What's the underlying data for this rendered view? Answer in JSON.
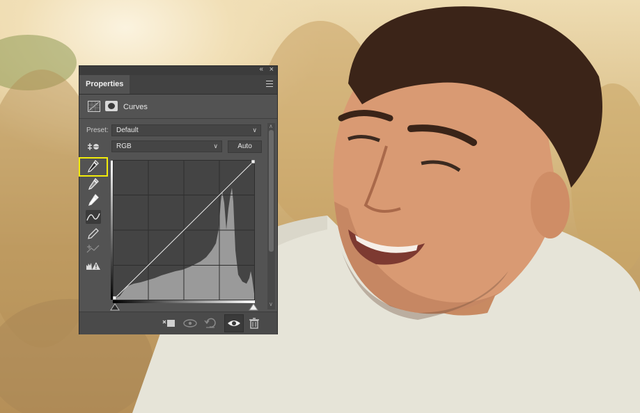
{
  "panel": {
    "tab_label": "Properties",
    "adjustment_title": "Curves",
    "preset_label": "Preset:",
    "preset_value": "Default",
    "channel_value": "RGB",
    "auto_label": "Auto"
  },
  "icons": {
    "panel_collapse": "double-chevron-left-icon",
    "panel_close": "close-icon",
    "panel_menu": "hamburger-menu-icon",
    "adjustment": "curves-adjustment-icon",
    "mask": "layer-mask-icon",
    "on_image": "on-image-adjust-icon",
    "black_point": "black-point-eyedropper-icon",
    "gray_point": "gray-point-eyedropper-icon",
    "white_point": "white-point-eyedropper-icon",
    "curve_edit": "edit-curve-points-icon",
    "pencil": "pencil-draw-icon",
    "smooth": "smooth-curve-icon",
    "clipping_warning": "clipping-warning-icon",
    "clip_to_layer": "clip-to-layer-icon",
    "view_previous": "view-previous-state-icon",
    "reset": "reset-icon",
    "visibility": "eye-icon",
    "delete": "trash-icon"
  },
  "colors": {
    "panel_bg": "#535353",
    "highlight": "#f2ec0a",
    "histogram": "#9a9a9a"
  }
}
